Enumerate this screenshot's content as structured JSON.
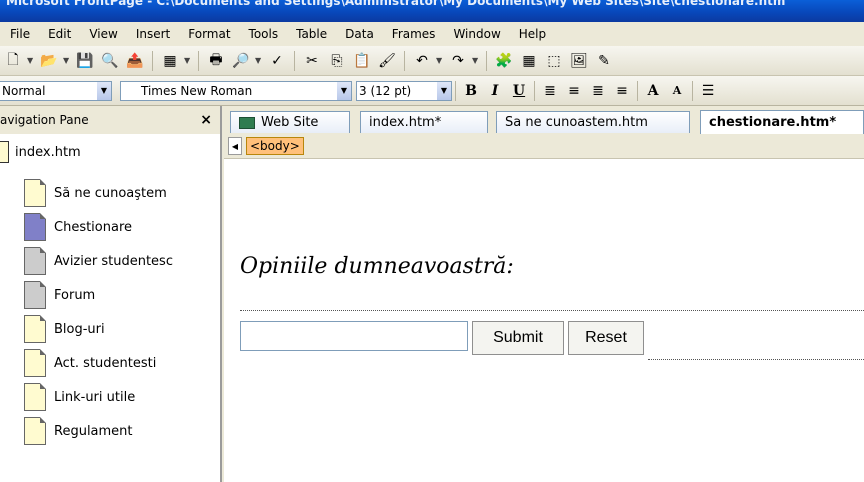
{
  "titlebar": {
    "title": "Microsoft FrontPage - C:\\Documents and Settings\\Administrator\\My Documents\\My Web Sites\\Site\\chestionare.htm"
  },
  "menu": [
    "File",
    "Edit",
    "View",
    "Insert",
    "Format",
    "Tools",
    "Table",
    "Data",
    "Frames",
    "Window",
    "Help"
  ],
  "formatting": {
    "style": "Normal",
    "font": "Times New Roman",
    "size": "3 (12 pt)",
    "bold": "B",
    "italic": "I",
    "underline": "U",
    "grow_font": "A",
    "shrink_font": "A"
  },
  "nav": {
    "title": "avigation Pane",
    "close": "×",
    "root": "index.htm",
    "items": [
      {
        "label": "Să ne cunoaştem",
        "color": "#fffbd0"
      },
      {
        "label": "Chestionare",
        "color": "#8080c8"
      },
      {
        "label": "Avizier studentesc",
        "color": "#cccccc"
      },
      {
        "label": "Forum",
        "color": "#cccccc"
      },
      {
        "label": "Blog-uri",
        "color": "#fffbd0"
      },
      {
        "label": "Act. studentesti",
        "color": "#fffbd0"
      },
      {
        "label": "Link-uri utile",
        "color": "#fffbd0"
      },
      {
        "label": "Regulament",
        "color": "#fffbd0"
      }
    ]
  },
  "tabs": [
    {
      "label": "Web Site"
    },
    {
      "label": "index.htm*"
    },
    {
      "label": "Sa ne cunoastem.htm"
    },
    {
      "label": "chestionare.htm*"
    }
  ],
  "quicktag": {
    "tag": "<body>"
  },
  "page": {
    "heading": "Opiniile dumneavoastră:",
    "input_value": "",
    "submit": "Submit",
    "reset": "Reset"
  }
}
